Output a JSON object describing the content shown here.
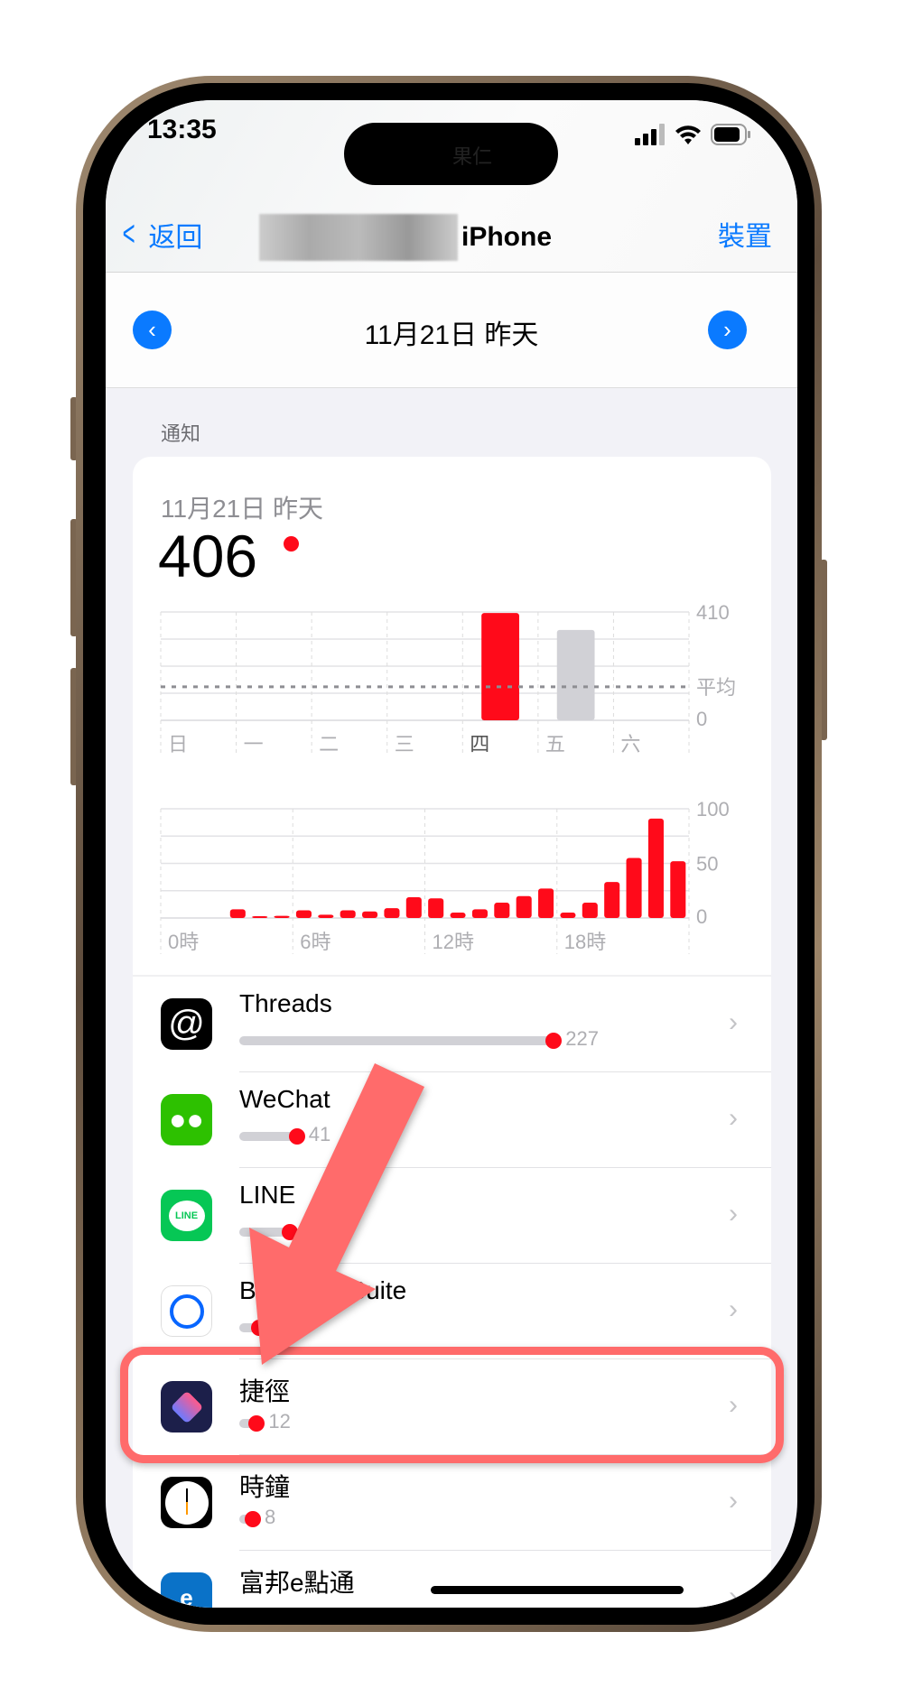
{
  "status": {
    "time": "13:35",
    "island_text": "果仁"
  },
  "nav": {
    "back": "返回",
    "title": "iPhone",
    "device": "裝置"
  },
  "date": {
    "label": "11月21日 昨天"
  },
  "section": "通知",
  "summary": {
    "subtitle": "11月21日 昨天",
    "total": "406"
  },
  "colors": {
    "accent": "#0a7aff",
    "red": "#ff0a1a",
    "gray_bar": "#d1d1d6",
    "annotation": "#ff6b6b"
  },
  "chart_data": [
    {
      "type": "bar",
      "categories": [
        "日",
        "一",
        "二",
        "三",
        "四",
        "五",
        "六"
      ],
      "values": [
        0,
        0,
        0,
        0,
        406,
        342,
        0
      ],
      "highlight": "四",
      "ylim": [
        0,
        410
      ],
      "yticks": [
        "410",
        "平均",
        "0"
      ],
      "average": 127,
      "grid": true
    },
    {
      "type": "bar",
      "categories": [
        "0",
        "1",
        "2",
        "3",
        "4",
        "5",
        "6",
        "7",
        "8",
        "9",
        "10",
        "11",
        "12",
        "13",
        "14",
        "15",
        "16",
        "17",
        "18",
        "19",
        "20",
        "21",
        "22",
        "23"
      ],
      "values": [
        0,
        0,
        0,
        8,
        1,
        2,
        7,
        3,
        7,
        6,
        9,
        19,
        18,
        5,
        8,
        14,
        20,
        27,
        5,
        14,
        33,
        55,
        91,
        52
      ],
      "xticks": [
        "0時",
        "6時",
        "12時",
        "18時"
      ],
      "ylim": [
        0,
        100
      ],
      "yticks": [
        "100",
        "50",
        "0"
      ],
      "grid": true
    }
  ],
  "apps": [
    {
      "name": "Threads",
      "count": "227",
      "value": 227,
      "icon": "threads-icon"
    },
    {
      "name": "WeChat",
      "count": "41",
      "value": 41,
      "icon": "wechat-icon"
    },
    {
      "name": "LINE",
      "count": "",
      "value": 36,
      "icon": "line-icon"
    },
    {
      "name": "Business Suite",
      "count": "4",
      "value": 14,
      "icon": "business-suite-icon"
    },
    {
      "name": "捷徑",
      "count": "12",
      "value": 12,
      "icon": "shortcuts-icon"
    },
    {
      "name": "時鐘",
      "count": "8",
      "value": 8,
      "icon": "clock-icon"
    },
    {
      "name": "富邦e點通",
      "count": "",
      "value": 0,
      "icon": "fubon-icon"
    }
  ]
}
